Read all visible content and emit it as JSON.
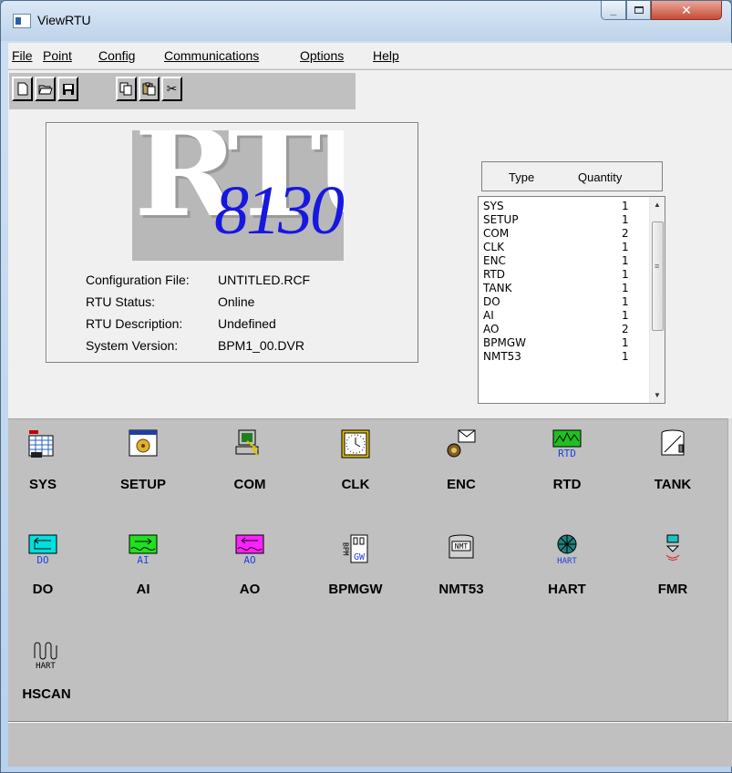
{
  "window": {
    "title": "ViewRTU"
  },
  "menu": [
    {
      "label": "File",
      "name": "menu-file"
    },
    {
      "label": "Point",
      "name": "menu-point"
    },
    {
      "label": "Config",
      "name": "menu-config"
    },
    {
      "label": "Communications",
      "name": "menu-communications"
    },
    {
      "label": "Options",
      "name": "menu-options"
    },
    {
      "label": "Help",
      "name": "menu-help"
    }
  ],
  "toolbar": [
    "new-file-icon",
    "open-folder-icon",
    "save-disk-icon",
    "copy-icon",
    "paste-icon",
    "cut-icon"
  ],
  "logo": {
    "brand": "RTU",
    "model": "8130"
  },
  "info": [
    {
      "label": "Configuration File:",
      "value": "UNTITLED.RCF"
    },
    {
      "label": "RTU Status:",
      "value": "Online"
    },
    {
      "label": "RTU Description:",
      "value": "Undefined"
    },
    {
      "label": "System Version:",
      "value": "BPM1_00.DVR"
    }
  ],
  "type_table": {
    "headers": [
      "Type",
      "Quantity"
    ],
    "rows": [
      {
        "type": "SYS",
        "qty": "1"
      },
      {
        "type": "SETUP",
        "qty": "1"
      },
      {
        "type": "COM",
        "qty": "2"
      },
      {
        "type": "CLK",
        "qty": "1"
      },
      {
        "type": "ENC",
        "qty": "1"
      },
      {
        "type": "RTD",
        "qty": "1"
      },
      {
        "type": "TANK",
        "qty": "1"
      },
      {
        "type": "DO",
        "qty": "1"
      },
      {
        "type": "AI",
        "qty": "1"
      },
      {
        "type": "AO",
        "qty": "2"
      },
      {
        "type": "BPMGW",
        "qty": "1"
      },
      {
        "type": "NMT53",
        "qty": "1"
      }
    ]
  },
  "points": [
    {
      "label": "SYS",
      "icon": "sys-grid-icon"
    },
    {
      "label": "SETUP",
      "icon": "setup-gear-window-icon"
    },
    {
      "label": "COM",
      "icon": "com-computer-icon"
    },
    {
      "label": "CLK",
      "icon": "clock-icon"
    },
    {
      "label": "ENC",
      "icon": "encoder-envelope-icon"
    },
    {
      "label": "RTD",
      "icon": "rtd-sensor-icon"
    },
    {
      "label": "TANK",
      "icon": "tank-icon"
    },
    {
      "label": "DO",
      "icon": "digital-output-icon"
    },
    {
      "label": "AI",
      "icon": "analog-input-icon"
    },
    {
      "label": "AO",
      "icon": "analog-output-icon"
    },
    {
      "label": "BPMGW",
      "icon": "bpm-gateway-icon"
    },
    {
      "label": "NMT53",
      "icon": "nmt-gauge-icon"
    },
    {
      "label": "HART",
      "icon": "hart-device-icon"
    },
    {
      "label": "FMR",
      "icon": "fmr-radar-icon"
    },
    {
      "label": "HSCAN",
      "icon": "hart-scan-icon"
    }
  ],
  "icon_text": {
    "rtd": "RTD",
    "do": "DO",
    "ai": "AI",
    "ao": "AO",
    "bpm": "BPM",
    "gw": "GW",
    "nmt": "NMT",
    "hart": "HART"
  }
}
